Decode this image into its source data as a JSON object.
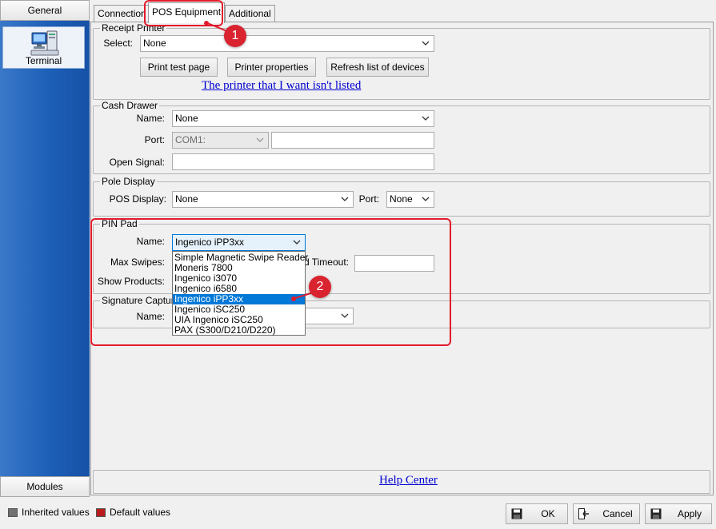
{
  "nav": {
    "general_label": "General",
    "terminal_label": "Terminal",
    "modules_label": "Modules"
  },
  "tabs": [
    {
      "label": "Connection"
    },
    {
      "label": "POS Equipment"
    },
    {
      "label": "Additional"
    }
  ],
  "receipt_printer": {
    "title": "Receipt Printer",
    "select_label": "Select:",
    "select_value": "None",
    "print_test_label": "Print test page",
    "printer_properties_label": "Printer properties",
    "refresh_label": "Refresh list of devices",
    "missing_link": "The printer that I want isn't listed"
  },
  "cash_drawer": {
    "title": "Cash Drawer",
    "name_label": "Name:",
    "name_value": "None",
    "port_label": "Port:",
    "port_value": "COM1:",
    "open_signal_label": "Open Signal:"
  },
  "pole_display": {
    "title": "Pole Display",
    "pos_display_label": "POS Display:",
    "pos_display_value": "None",
    "port_label": "Port:",
    "port_value": "None"
  },
  "pin_pad": {
    "title": "PIN Pad",
    "name_label": "Name:",
    "name_value": "Ingenico iPP3xx",
    "max_swipes_label": "Max Swipes:",
    "timeout_label": "d Timeout:",
    "show_products_label": "Show Products:",
    "options": [
      "Simple Magnetic Swipe Reader",
      "Moneris 7800",
      "Ingenico i3070",
      "Ingenico i6580",
      "Ingenico iPP3xx",
      "Ingenico iSC250",
      "UIA Ingenico iSC250",
      "PAX (S300/D210/D220)"
    ],
    "selected_index": 4
  },
  "signature_capture": {
    "title": "Signature Capture",
    "name_label": "Name:"
  },
  "help_center_link": "Help Center",
  "annotations": {
    "badge1": "1",
    "badge2": "2",
    "color": "#e21b2b"
  },
  "footer": {
    "inherited_label": "Inherited values",
    "default_label": "Default values",
    "inherited_color": "#707070",
    "default_color": "#b71c1c",
    "ok_label": "OK",
    "cancel_label": "Cancel",
    "apply_label": "Apply"
  },
  "icons": [
    "terminal-icon",
    "chevron-down-icon",
    "save-icon",
    "cancel-icon"
  ]
}
